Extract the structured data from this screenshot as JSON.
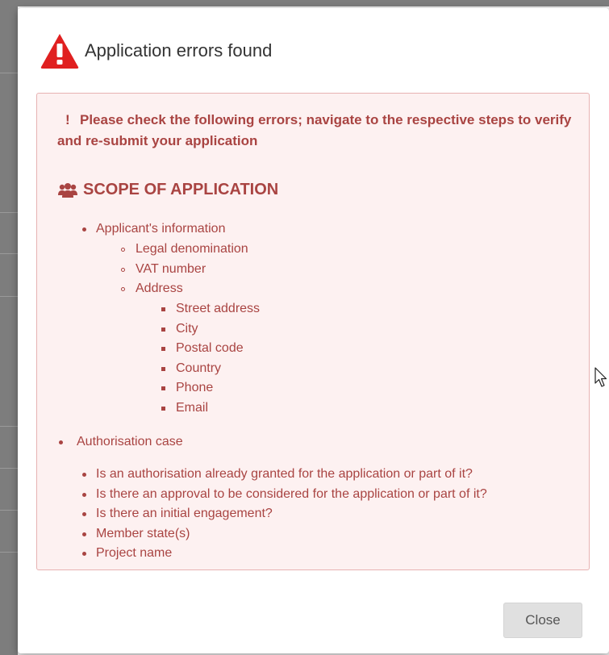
{
  "modal": {
    "title": "Application errors found",
    "icon": "warning-triangle-icon",
    "accent_color": "#e02020",
    "close_label": "Close"
  },
  "errors": {
    "box_background": "#fdf1f1",
    "text_color": "#a94442",
    "intro_bang": "!",
    "intro_text": "Please check the following errors; navigate to the respective steps to verify and re-submit your application",
    "section": {
      "icon": "users-icon",
      "title": "SCOPE OF APPLICATION"
    },
    "applicant": {
      "label": "Applicant's information",
      "items": [
        "Legal denomination",
        "VAT number",
        "Address"
      ],
      "address_items": [
        "Street address",
        "City",
        "Postal code",
        "Country",
        "Phone",
        "Email"
      ]
    },
    "authorisation": {
      "label": "Authorisation case",
      "items": [
        "Is an authorisation already granted for the application or part of it?",
        "Is there an approval to be considered for the application or part of it?",
        "Is there an initial engagement?",
        "Member state(s)",
        "Project name"
      ]
    }
  }
}
